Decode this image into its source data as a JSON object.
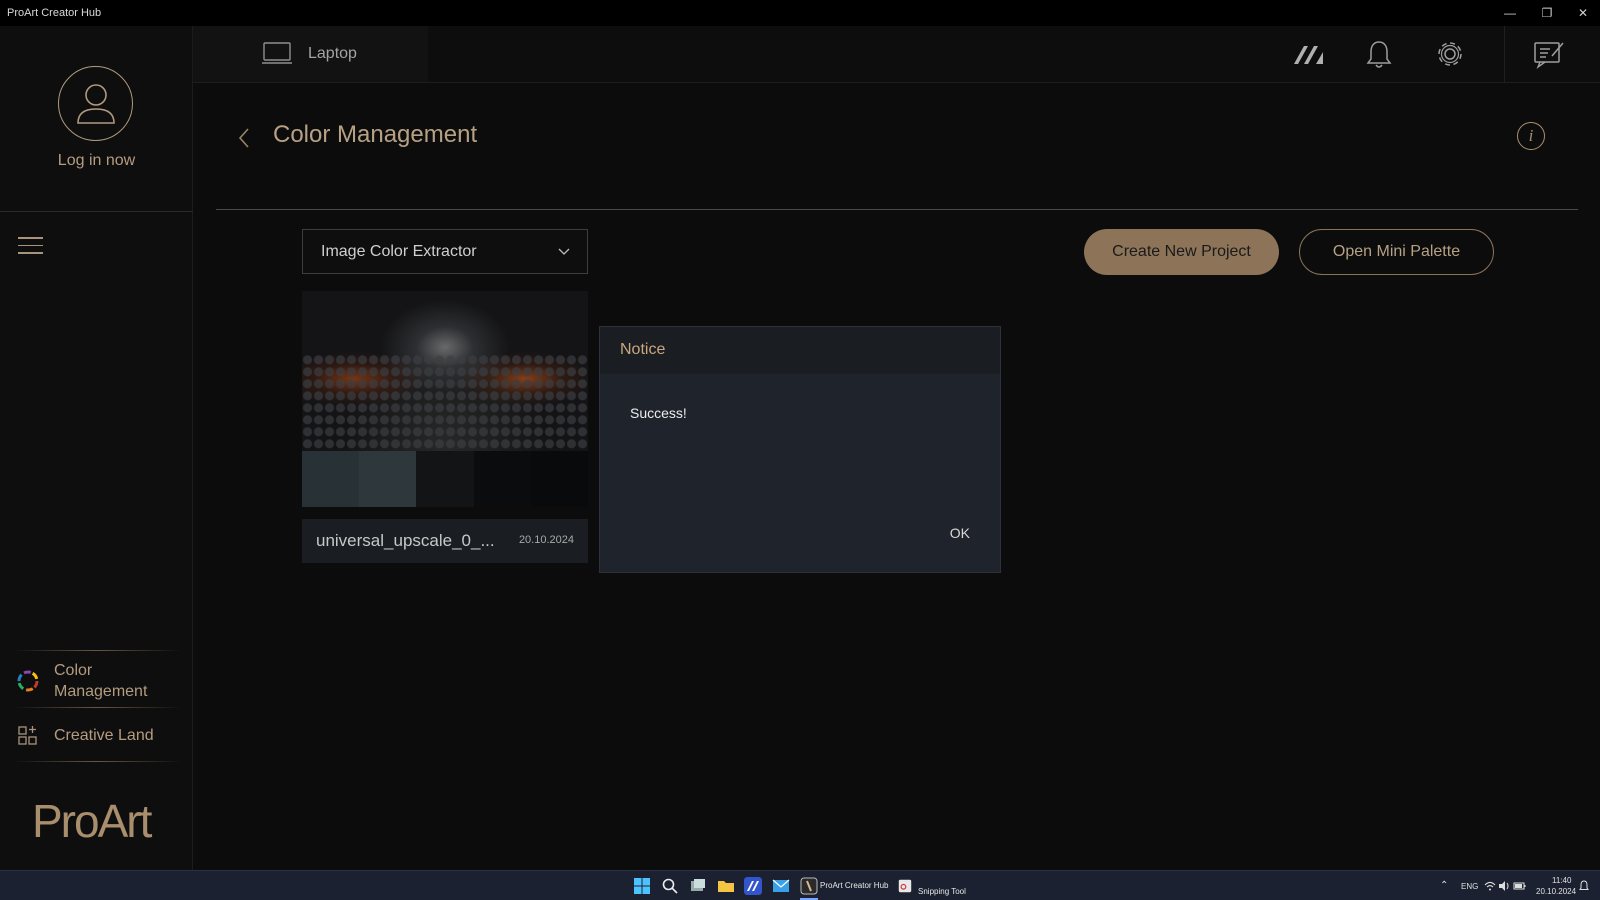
{
  "window": {
    "title": "ProArt Creator Hub",
    "controls": [
      "minimize",
      "restore",
      "close"
    ]
  },
  "sidebar": {
    "login_label": "Log in now",
    "menu_icon": "hamburger-icon",
    "nav_items": [
      {
        "label": "Color Management",
        "icon": "color-wheel-icon"
      },
      {
        "label": "Creative Land",
        "icon": "grid-plus-icon"
      }
    ],
    "brand": "ProArt"
  },
  "topbar": {
    "device_label": "Laptop",
    "icons": [
      "armoury-logo-icon",
      "bell-icon",
      "gear-icon",
      "feedback-icon"
    ]
  },
  "page": {
    "title": "Color Management",
    "mode_select": {
      "selected": "Image Color Extractor"
    },
    "create_button": "Create New Project",
    "palette_button": "Open Mini Palette"
  },
  "project_card": {
    "name": "universal_upscale_0_...",
    "date": "20.10.2024",
    "swatches": [
      "#283136",
      "#2d373c",
      "#121415",
      "#0b0c0d",
      "#090a0b"
    ]
  },
  "dialog": {
    "title": "Notice",
    "message": "Success!",
    "ok_label": "OK"
  },
  "taskbar": {
    "apps": [
      "windows-start-icon",
      "search-icon",
      "task-view-icon",
      "file-explorer-icon",
      "armoury-crate-icon",
      "mail-icon"
    ],
    "active_app": "ProArt Creator Hub",
    "snipping": "Snipping Tool",
    "language": "ENG",
    "time": "11:40",
    "date": "20.10.2024"
  },
  "colors": {
    "accent": "#b39c80",
    "button_fill": "#8d7458",
    "dialog_bg": "#1f242c",
    "background": "#0c0c0c"
  }
}
